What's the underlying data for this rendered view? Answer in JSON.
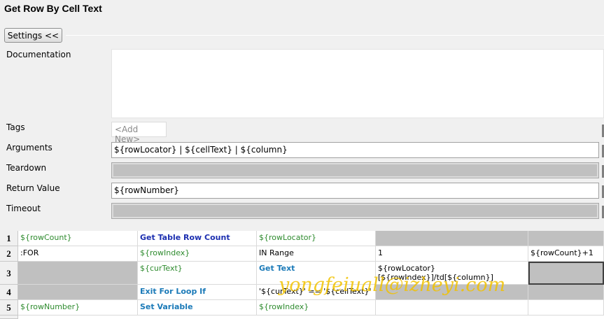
{
  "title": "Get Row By Cell Text",
  "settings_button": "Settings <<",
  "labels": {
    "documentation": "Documentation",
    "tags": "Tags",
    "arguments": "Arguments",
    "teardown": "Teardown",
    "return_value": "Return Value",
    "timeout": "Timeout"
  },
  "tags_placeholder": "<Add New>",
  "arguments_value": "${rowLocator} | ${cellText} | ${column}",
  "teardown_value": "",
  "return_value": "${rowNumber}",
  "timeout_value": "",
  "rows": [
    {
      "num": "1",
      "cells": [
        "${rowCount}",
        "Get Table Row Count",
        "${rowLocator}",
        "",
        ""
      ]
    },
    {
      "num": "2",
      "cells": [
        ":FOR",
        "${rowIndex}",
        "IN Range",
        "1",
        "${rowCount}+1"
      ]
    },
    {
      "num": "3",
      "cells": [
        "",
        "${curText}",
        "Get Text",
        "${rowLocator}[${rowIndex}]/td[${column}]",
        ""
      ]
    },
    {
      "num": "4",
      "cells": [
        "",
        "Exit For Loop If",
        "'${curText}' == '${cellText}'",
        "",
        ""
      ]
    },
    {
      "num": "5",
      "cells": [
        "${rowNumber}",
        "Set Variable",
        "${rowIndex}",
        "",
        ""
      ]
    }
  ],
  "watermark": "yongfeiuall@izheyi.com",
  "colors": {
    "variable": "#2e8b2e",
    "keyword": "#1c2fb0",
    "builtin": "#1b7ab8",
    "disabled": "#c0c0c0",
    "watermark": "#f2c200"
  }
}
